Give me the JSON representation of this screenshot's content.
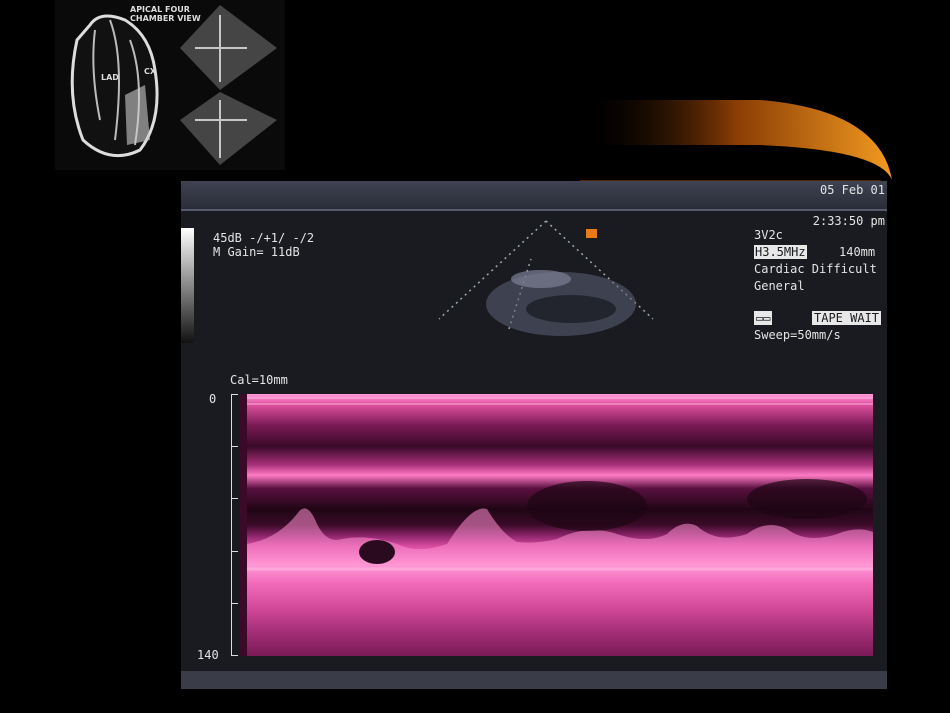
{
  "diagram": {
    "title": "APICAL FOUR\nCHAMBER VIEW",
    "label_lad": "LAD",
    "label_cx": "CX"
  },
  "screen": {
    "date": "05 Feb 01",
    "time": "2:33:50 pm",
    "db": "45dB    -/+1/ -/2",
    "gain": "M Gain=  11dB",
    "probe": "3V2c",
    "frequency": "H3.5MHz",
    "depth": "140mm",
    "preset": "Cardiac Difficult",
    "mode": "General",
    "tape_icon": "▭▭",
    "tape_status": "TAPE WAIT",
    "sweep": "Sweep=50mm/s",
    "cal": "Cal=10mm",
    "scale_top": "0",
    "scale_bottom": "140"
  },
  "colors": {
    "mmode_magenta": "#e0509e",
    "screen_background": "#1a1b20",
    "swoosh_orange": "#e07a10"
  }
}
